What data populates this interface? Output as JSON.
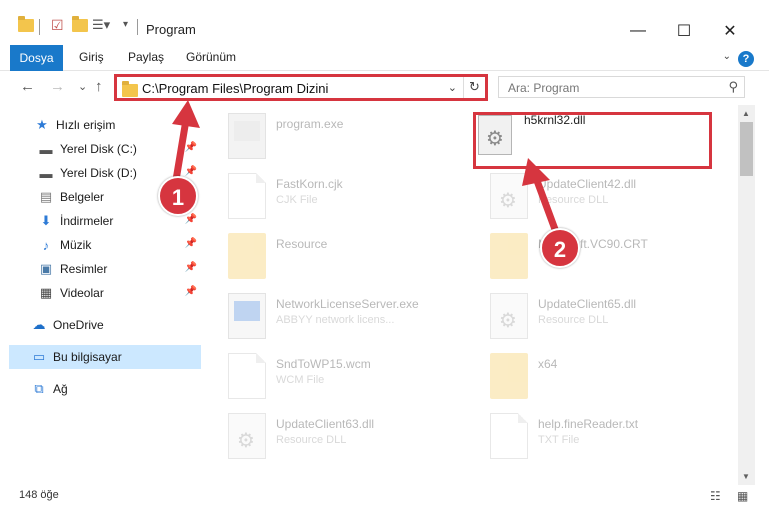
{
  "window": {
    "title": "Program",
    "controls": {
      "minimize": "—",
      "maximize": "☐",
      "close": "✕"
    }
  },
  "ribbon": {
    "tabs": [
      "Dosya",
      "Giriş",
      "Paylaş",
      "Görünüm"
    ],
    "help": "?"
  },
  "nav": {
    "back": "←",
    "forward": "→",
    "dropdown": "⌄",
    "up": "↑",
    "address": "C:\\Program Files\\Program Dizini",
    "search_placeholder": "Ara: Program"
  },
  "sidebar": {
    "quick_access": "Hızlı erişim",
    "items": [
      {
        "label": "Yerel Disk (C:)",
        "icon": "drive-icon",
        "pinned": true
      },
      {
        "label": "Yerel Disk (D:)",
        "icon": "drive-icon",
        "pinned": true
      },
      {
        "label": "Belgeler",
        "icon": "documents-icon",
        "pinned": true
      },
      {
        "label": "İndirmeler",
        "icon": "downloads-icon",
        "pinned": true
      },
      {
        "label": "Müzik",
        "icon": "music-icon",
        "pinned": true
      },
      {
        "label": "Resimler",
        "icon": "pictures-icon",
        "pinned": true
      },
      {
        "label": "Videolar",
        "icon": "videos-icon",
        "pinned": true
      }
    ],
    "onedrive": "OneDrive",
    "this_pc": "Bu bilgisayar",
    "network": "Ağ"
  },
  "files": [
    {
      "name": "program.exe",
      "type": ""
    },
    {
      "name": "h5krnl32.dll",
      "type": ""
    },
    {
      "name": "FastKorn.cjk",
      "type": "CJK File"
    },
    {
      "name": "UpdateClient42.dll",
      "type": "Resource DLL"
    },
    {
      "name": "Resource",
      "type": ""
    },
    {
      "name": "Microsoft.VC90.CRT",
      "type": ""
    },
    {
      "name": "NetworkLicenseServer.exe",
      "type": "ABBYY network licens..."
    },
    {
      "name": "UpdateClient65.dll",
      "type": "Resource DLL"
    },
    {
      "name": "SndToWP15.wcm",
      "type": "WCM File"
    },
    {
      "name": "x64",
      "type": ""
    },
    {
      "name": "UpdateClient63.dll",
      "type": "Resource DLL"
    },
    {
      "name": "help.fineReader.txt",
      "type": "TXT File"
    }
  ],
  "status": {
    "count": "148 öğe"
  },
  "annotations": {
    "badge1": "1",
    "badge2": "2"
  },
  "colors": {
    "accent": "#1979ca",
    "annotation": "#d6353f",
    "selected": "#cce8ff"
  }
}
